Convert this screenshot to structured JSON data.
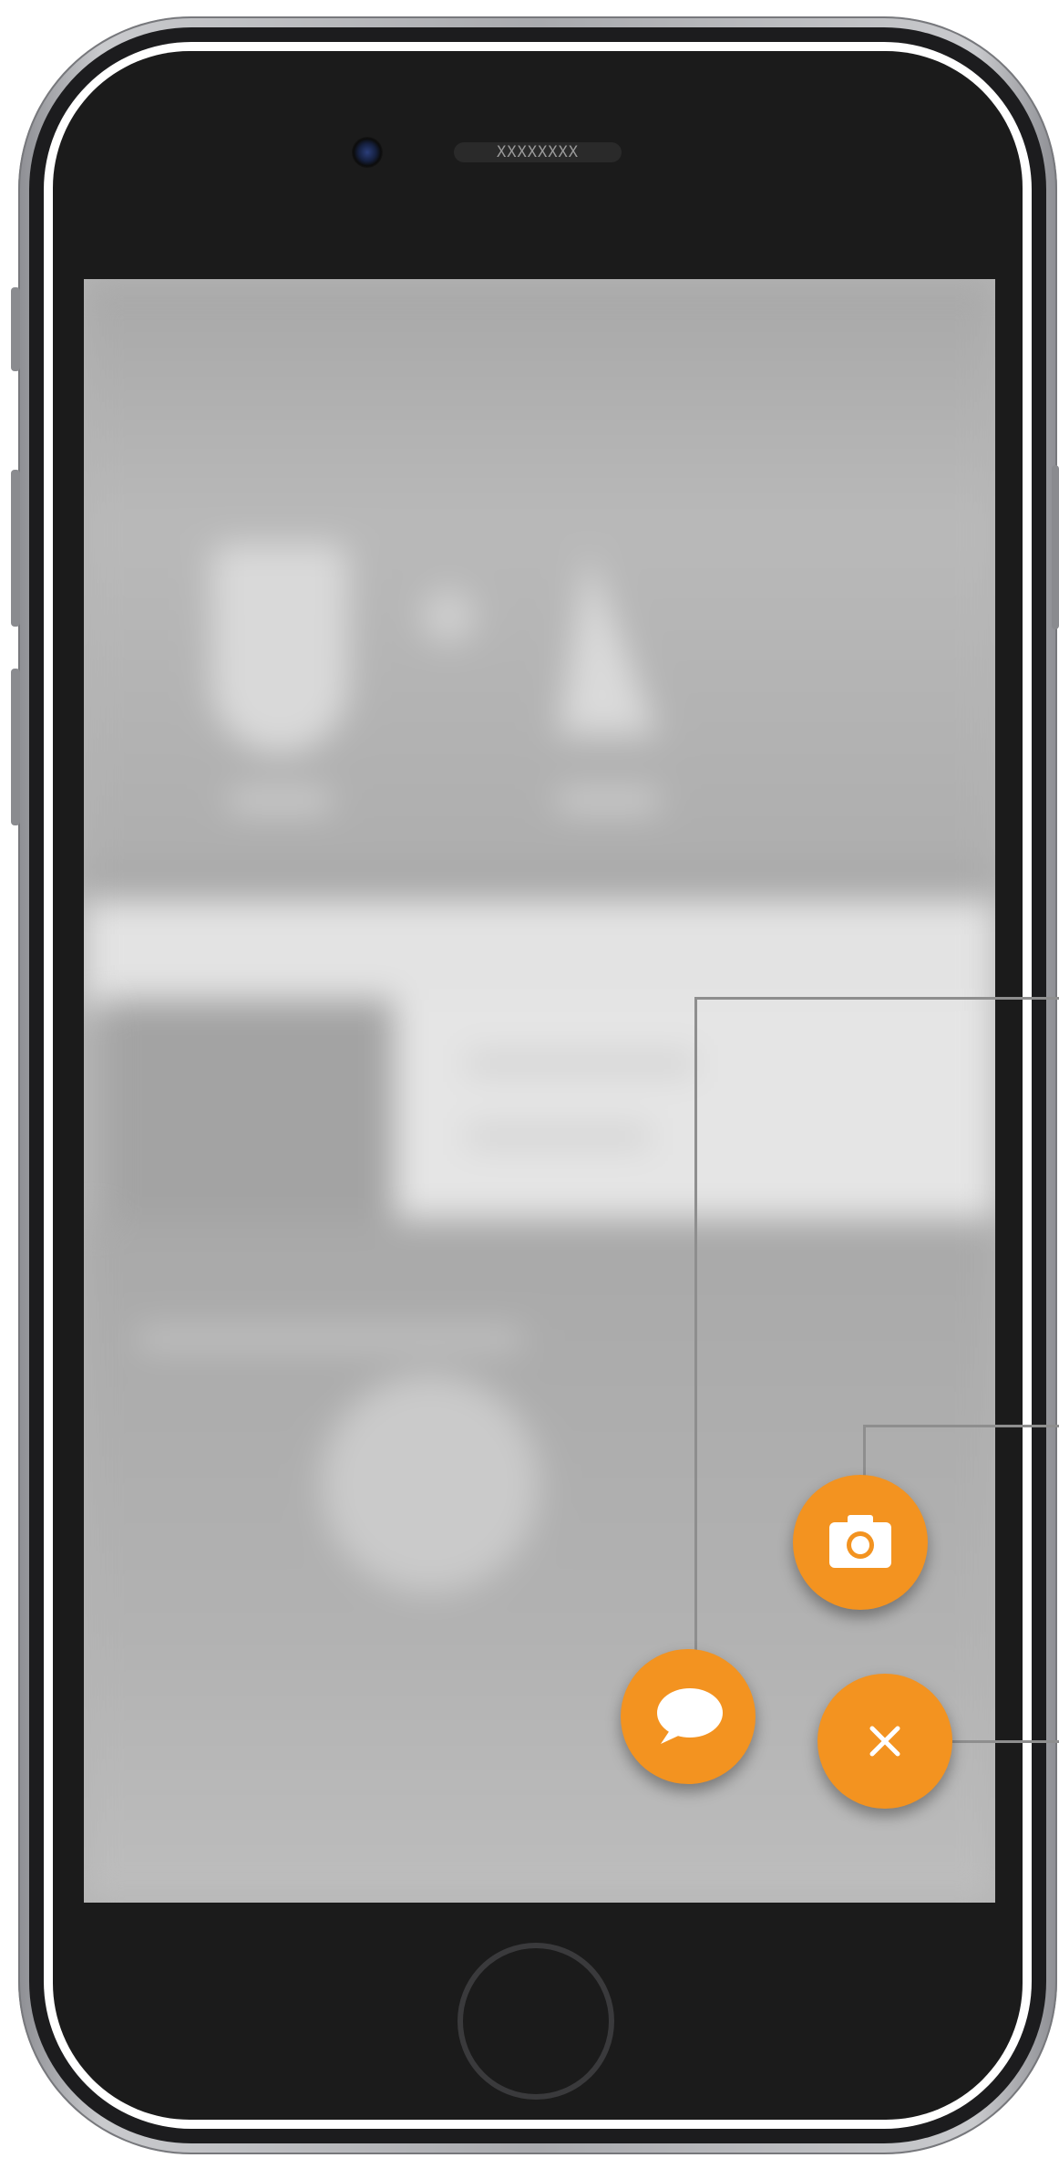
{
  "device": {
    "speaker_text": "XXXXXXXX"
  },
  "fabs": [
    {
      "name": "chat",
      "icon": "speech-bubble-icon",
      "color": "#f39320"
    },
    {
      "name": "camera",
      "icon": "camera-icon",
      "color": "#f39320"
    },
    {
      "name": "close",
      "icon": "close-icon",
      "color": "#f39320"
    }
  ]
}
